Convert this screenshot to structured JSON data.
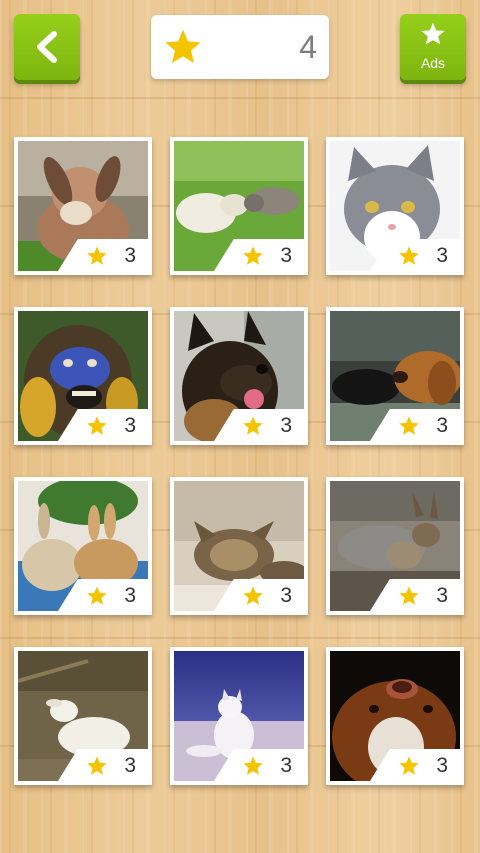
{
  "header": {
    "back_icon": "chevron-left-icon",
    "score_icon": "star-icon",
    "score_value": "4",
    "ads_icon": "star-icon",
    "ads_label": "Ads"
  },
  "colors": {
    "button_green": "#8bc417",
    "star_yellow": "#f5c400",
    "score_text": "#7d7d7d"
  },
  "levels": [
    {
      "subject": "rabbit",
      "stars": "3"
    },
    {
      "subject": "lambs",
      "stars": "3"
    },
    {
      "subject": "cat",
      "stars": "3"
    },
    {
      "subject": "monkey",
      "stars": "3"
    },
    {
      "subject": "german-shepherd",
      "stars": "3"
    },
    {
      "subject": "cat-and-dog",
      "stars": "3"
    },
    {
      "subject": "rabbits",
      "stars": "3"
    },
    {
      "subject": "kitten",
      "stars": "3"
    },
    {
      "subject": "mara",
      "stars": "3"
    },
    {
      "subject": "lamb",
      "stars": "3"
    },
    {
      "subject": "arctic-fox",
      "stars": "3"
    },
    {
      "subject": "dog",
      "stars": "3"
    }
  ]
}
